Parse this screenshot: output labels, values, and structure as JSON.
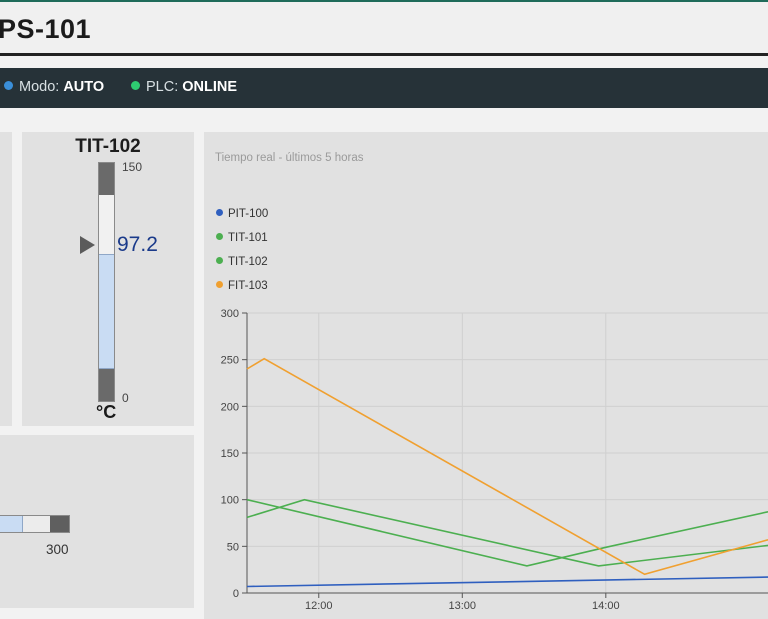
{
  "header": {
    "title": "PS-101"
  },
  "status": {
    "mode": {
      "label": "Modo:",
      "value": "AUTO",
      "color": "#3a8fd9"
    },
    "plc": {
      "label": "PLC:",
      "value": "ONLINE",
      "color": "#2ecc71"
    }
  },
  "tit_gauge": {
    "title": "TIT-102",
    "max_label": "150",
    "min_label": "0",
    "min": 0,
    "max": 150,
    "value": 97.2,
    "value_label": "97.2",
    "unit": "°C"
  },
  "bar_gauge": {
    "max_label": "300"
  },
  "chart": {
    "subtitle": "Tiempo real - últimos 5 horas"
  },
  "chart_data": {
    "type": "line",
    "subtitle": "Tiempo real - últimos 5 horas",
    "xlabel": "",
    "ylabel": "",
    "ylim": [
      0,
      300
    ],
    "yticks": [
      0,
      50,
      100,
      150,
      200,
      250,
      300
    ],
    "xticks": [
      "12:00",
      "13:00",
      "14:00"
    ],
    "x_domain_hours": [
      11.5,
      15.13
    ],
    "grid": true,
    "legend": "top-left",
    "series": [
      {
        "name": "PIT-100",
        "color": "#2f5fbf",
        "x": [
          11.5,
          15.13
        ],
        "y": [
          7,
          17
        ]
      },
      {
        "name": "TIT-101",
        "color": "#4caf50",
        "x": [
          11.5,
          13.45,
          14.0,
          15.13
        ],
        "y": [
          100,
          29,
          49,
          87
        ]
      },
      {
        "name": "TIT-102",
        "color": "#4caf50",
        "x": [
          11.5,
          11.9,
          13.95,
          15.13
        ],
        "y": [
          81,
          100,
          29,
          51
        ]
      },
      {
        "name": "FIT-103",
        "color": "#f0a030",
        "x": [
          11.5,
          11.62,
          14.27,
          15.13
        ],
        "y": [
          240,
          251,
          20,
          57
        ]
      }
    ]
  }
}
